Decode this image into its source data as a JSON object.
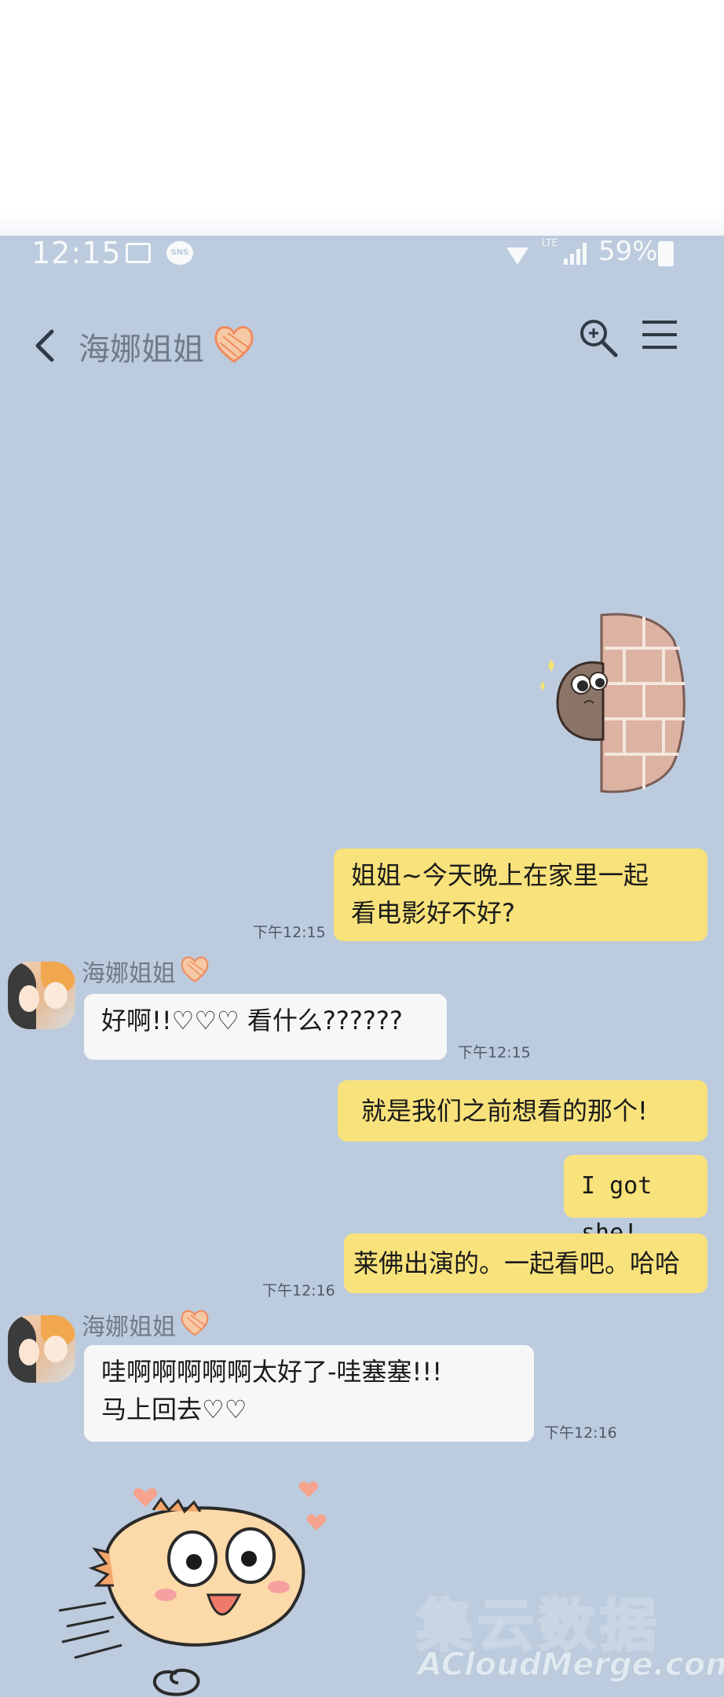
{
  "status_bar": {
    "time": "12:15",
    "sns_label": "SNS",
    "lte_label": "LTE",
    "battery": "59%"
  },
  "header": {
    "title": "海娜姐姐"
  },
  "messages": [
    {
      "side": "me",
      "text": "姐姐~今天晚上在家里一起\n看电影好不好?",
      "time": "下午12:15"
    },
    {
      "side": "them",
      "sender": "海娜姐姐",
      "text": "好啊!!♡♡♡ 看什么??????",
      "time": "下午12:15"
    },
    {
      "side": "me",
      "text": "就是我们之前想看的那个!"
    },
    {
      "side": "me",
      "text": "I got she!"
    },
    {
      "side": "me",
      "text": "莱佛出演的。一起看吧。哈哈",
      "time": "下午12:16"
    },
    {
      "side": "them",
      "sender": "海娜姐姐",
      "text": "哇啊啊啊啊啊太好了-哇塞塞!!!\n马上回去♡♡",
      "time": "下午12:16"
    }
  ],
  "watermark": {
    "cn": "集云数据",
    "en": "ACloudMerge.com"
  },
  "colors": {
    "background": "#bccbdd",
    "my_bubble": "#f8e27b",
    "their_bubble": "#f7f7f7",
    "heart": "#f08b5e"
  }
}
